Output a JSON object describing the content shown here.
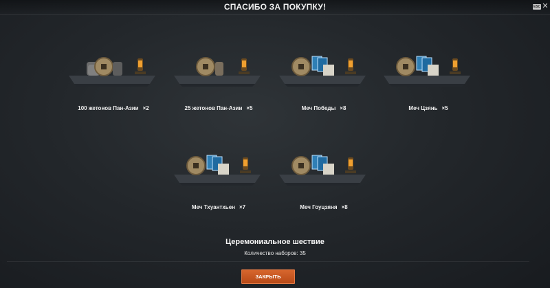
{
  "header": {
    "title": "СПАСИБО ЗА ПОКУПКУ!",
    "esc_label": "ESC",
    "close_icon": "close-icon"
  },
  "rewards": [
    {
      "name": "100 жетонов Пан-Азии",
      "qty": "×2",
      "art": "tokens"
    },
    {
      "name": "25 жетонов Пан-Азии",
      "qty": "×5",
      "art": "tokens"
    },
    {
      "name": "Меч Победы",
      "qty": "×8",
      "art": "cards"
    },
    {
      "name": "Меч Цзянь",
      "qty": "×5",
      "art": "cards"
    },
    {
      "name": "Меч Тхуантхьен",
      "qty": "×7",
      "art": "cards"
    },
    {
      "name": "Меч Гоуцзяня",
      "qty": "×8",
      "art": "cards"
    }
  ],
  "summary": {
    "set_name": "Церемониальное шествие",
    "set_count": "Количество наборов: 35"
  },
  "footer": {
    "close_label": "ЗАКРЫТЬ"
  },
  "colors": {
    "accent": "#c9561f",
    "background": "#23272b"
  }
}
